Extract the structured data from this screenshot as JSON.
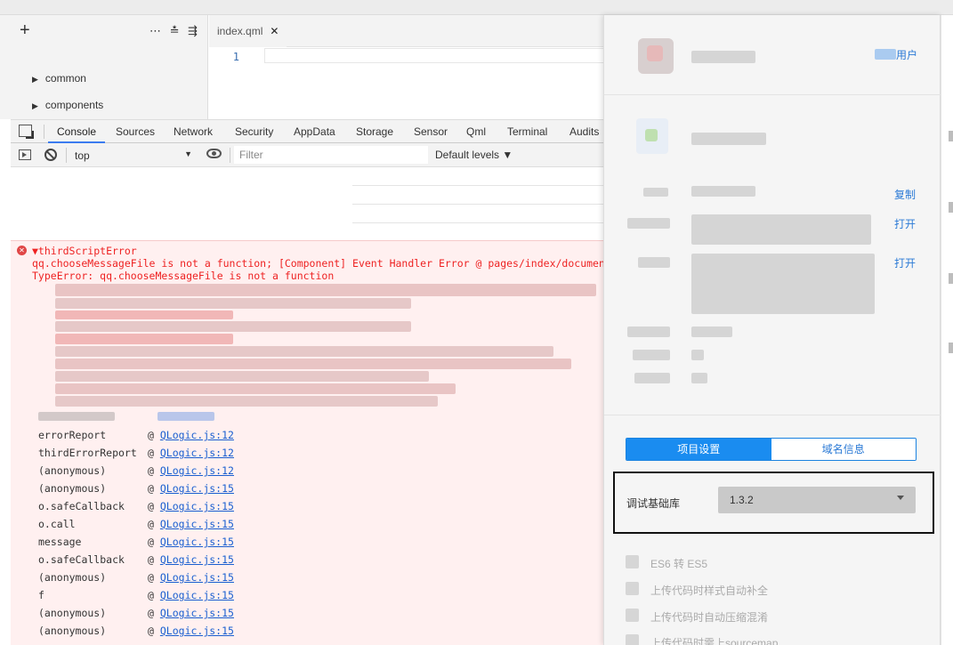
{
  "filetree": {
    "add_label": "+",
    "tools": "⋯ ≛ ⇶",
    "items": [
      {
        "label": "common"
      },
      {
        "label": "components"
      }
    ]
  },
  "editor": {
    "tab": {
      "label": "index.qml",
      "close": "✕"
    },
    "line_numbers": [
      "1"
    ]
  },
  "devtools": {
    "tabs": [
      "Console",
      "Sources",
      "Network",
      "Security",
      "AppData",
      "Storage",
      "Sensor",
      "Qml",
      "Terminal",
      "Audits"
    ],
    "active_tab": "Console",
    "context": "top",
    "filter_placeholder": "Filter",
    "levels": "Default levels ▼"
  },
  "console_error": {
    "title": "▼thirdScriptError",
    "line1": "qq.chooseMessageFile is not a function; [Component] Event Handler Error @ pages/index/document-preview#(anonymous)",
    "line2": "TypeError: qq.chooseMessageFile is not a function",
    "stack": [
      {
        "fn": "errorReport",
        "file": "QLogic.js:12"
      },
      {
        "fn": "thirdErrorReport",
        "file": "QLogic.js:12"
      },
      {
        "fn": "(anonymous)",
        "file": "QLogic.js:12"
      },
      {
        "fn": "(anonymous)",
        "file": "QLogic.js:15"
      },
      {
        "fn": "o.safeCallback",
        "file": "QLogic.js:15"
      },
      {
        "fn": "o.call",
        "file": "QLogic.js:15"
      },
      {
        "fn": "message",
        "file": "QLogic.js:15"
      },
      {
        "fn": "o.safeCallback",
        "file": "QLogic.js:15"
      },
      {
        "fn": "(anonymous)",
        "file": "QLogic.js:15"
      },
      {
        "fn": "f",
        "file": "QLogic.js:15"
      },
      {
        "fn": "(anonymous)",
        "file": "QLogic.js:15"
      },
      {
        "fn": "(anonymous)",
        "file": "QLogic.js:15"
      }
    ],
    "at_symbol": "@"
  },
  "panel": {
    "user_link": "用户",
    "rows": [
      {
        "link": "复制"
      },
      {
        "link": "打开"
      },
      {
        "link": "打开"
      }
    ],
    "segments": [
      "项目设置",
      "域名信息"
    ],
    "active_segment": "项目设置",
    "lib_label": "调试基础库",
    "lib_version": "1.3.2",
    "options": [
      {
        "label": "ES6 转 ES5"
      },
      {
        "label": "上传代码时样式自动补全"
      },
      {
        "label": "上传代码时自动压缩混淆"
      },
      {
        "label": "上传代码时需上sourcemap"
      }
    ]
  },
  "colors": {
    "accent": "#1a8cf0",
    "error_text": "#ee2222",
    "error_bg": "#fff0f0",
    "link": "#1a5fd0"
  }
}
